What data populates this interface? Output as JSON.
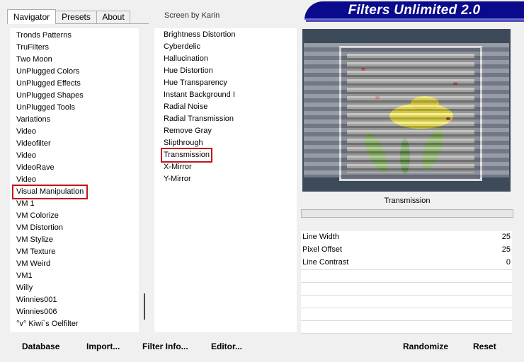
{
  "tabs": [
    {
      "label": "Navigator",
      "active": true
    },
    {
      "label": "Presets",
      "active": false
    },
    {
      "label": "About",
      "active": false
    }
  ],
  "credit": "Screen by Karin",
  "logo_text": "Filters Unlimited 2.0",
  "categories": [
    "Tronds Patterns",
    "TruFilters",
    "Two Moon",
    "UnPlugged Colors",
    "UnPlugged Effects",
    "UnPlugged Shapes",
    "UnPlugged Tools",
    "Variations",
    "Video",
    "Videofilter",
    "Video",
    "VideoRave",
    "Video",
    "Visual Manipulation",
    "VM 1",
    "VM Colorize",
    "VM Distortion",
    "VM Stylize",
    "VM Texture",
    "VM Weird",
    "VM1",
    "Willy",
    "Winnies001",
    "Winnies006",
    "°v° Kiwi`s Oelfilter"
  ],
  "selected_category": "Visual Manipulation",
  "filters": [
    "Brightness Distortion",
    "Cyberdelic",
    "Hallucination",
    "Hue Distortion",
    "Hue Transparency",
    "Instant Background I",
    "Radial Noise",
    "Radial Transmission",
    "Remove Gray",
    "Slipthrough",
    "Transmission",
    "X-Mirror",
    "Y-Mirror"
  ],
  "selected_filter": "Transmission",
  "preview_filter_name": "Transmission",
  "params": [
    {
      "name": "Line Width",
      "value": "25"
    },
    {
      "name": "Pixel Offset",
      "value": "25"
    },
    {
      "name": "Line Contrast",
      "value": "0"
    }
  ],
  "buttons": {
    "database": "Database",
    "import": "Import...",
    "filter_info": "Filter Info...",
    "editor": "Editor...",
    "randomize": "Randomize",
    "reset": "Reset"
  },
  "colors": {
    "logo_bg": "#0a0a8c",
    "selection_border": "#c0151e"
  }
}
